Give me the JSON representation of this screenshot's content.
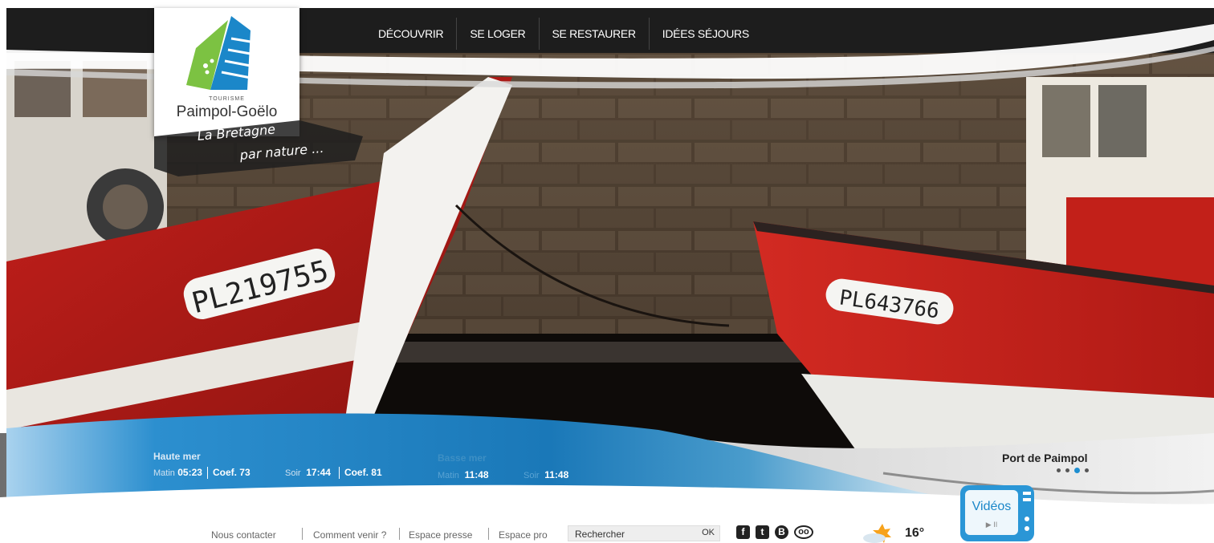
{
  "nav": {
    "items": [
      "DÉCOUVRIR",
      "SE LOGER",
      "SE RESTAURER",
      "IDÉES SÉJOURS"
    ]
  },
  "logo": {
    "tourisme": "TOURISME",
    "name": "Paimpol-Goëlo",
    "tagline_line1": "La Bretagne",
    "tagline_line2": "par nature ..."
  },
  "hero": {
    "boat_left_reg": "PL219755",
    "boat_right_reg": "PL643766",
    "caption": "Port de Paimpol",
    "slides": 4,
    "active_slide": 2
  },
  "tides": {
    "high": {
      "title": "Haute mer",
      "morning_label": "Matin",
      "morning_time": "05:23",
      "morning_coef": "Coef. 73",
      "evening_label": "Soir",
      "evening_time": "17:44",
      "evening_coef": "Coef. 81"
    },
    "low": {
      "title": "Basse mer",
      "morning_label": "Matin",
      "morning_time": "11:48",
      "evening_label": "Soir",
      "evening_time": "11:48"
    }
  },
  "footer": {
    "links": [
      "Nous contacter",
      "Comment venir ?",
      "Espace presse",
      "Espace pro"
    ],
    "search_value": "Rechercher",
    "search_ok": "OK",
    "temperature": "16°",
    "videos_label": "Vidéos",
    "video_controls": "▶ II",
    "social": {
      "facebook": "f",
      "twitter": "t",
      "blog": "B",
      "tripadvisor": "oo"
    }
  },
  "colors": {
    "topbar": "#1d1d1d",
    "tide_blue": "#1a78b8",
    "logo_green": "#7cc242",
    "logo_blue": "#1b87c9"
  }
}
